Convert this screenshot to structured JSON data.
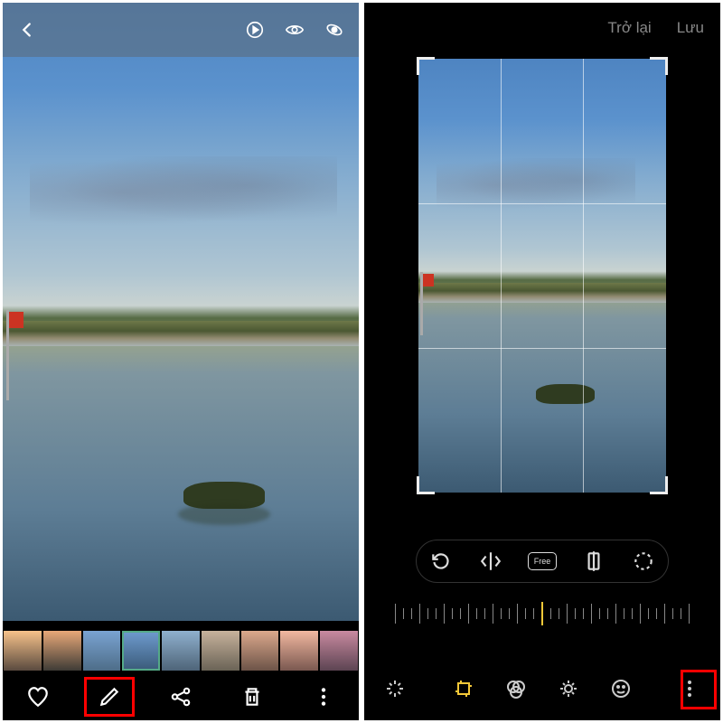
{
  "left": {
    "top_icons": [
      "motion-photo-icon",
      "visibility-icon",
      "dynamic-view-icon"
    ],
    "thumbnails": [
      {
        "bg": "linear-gradient(to bottom,#f7c28a,#5a4a3f)"
      },
      {
        "bg": "linear-gradient(to bottom,#e8a878,#3e3b36)"
      },
      {
        "bg": "linear-gradient(to bottom,#7aa3d2,#4e6d88)"
      },
      {
        "bg": "linear-gradient(to bottom,#6f9cd0,#3a5a78)",
        "active": true
      },
      {
        "bg": "linear-gradient(to bottom,#8fb0ce,#4e6478)"
      },
      {
        "bg": "linear-gradient(to bottom,#c7b29c,#6a6356)"
      },
      {
        "bg": "linear-gradient(to bottom,#dca98c,#6c5348)"
      },
      {
        "bg": "linear-gradient(to bottom,#f2b8a0,#7a5850)"
      },
      {
        "bg": "linear-gradient(to bottom,#c98aa0,#5c4452)"
      }
    ],
    "bottom_actions": [
      "favorite-icon",
      "edit-icon",
      "share-icon",
      "delete-icon",
      "more-icon"
    ],
    "highlighted_action": "edit-icon"
  },
  "right": {
    "header": {
      "back_label": "Trở lại",
      "save_label": "Lưu"
    },
    "crop_tools": [
      "rotate-icon",
      "flip-icon",
      "aspect-free-icon",
      "perspective-icon",
      "lasso-icon"
    ],
    "aspect_free_label": "Free",
    "edit_tabs": [
      "auto-icon",
      "transform-icon",
      "filters-icon",
      "adjust-icon",
      "stickers-icon"
    ],
    "active_tab": "transform-icon",
    "highlighted_action": "more-icon"
  }
}
